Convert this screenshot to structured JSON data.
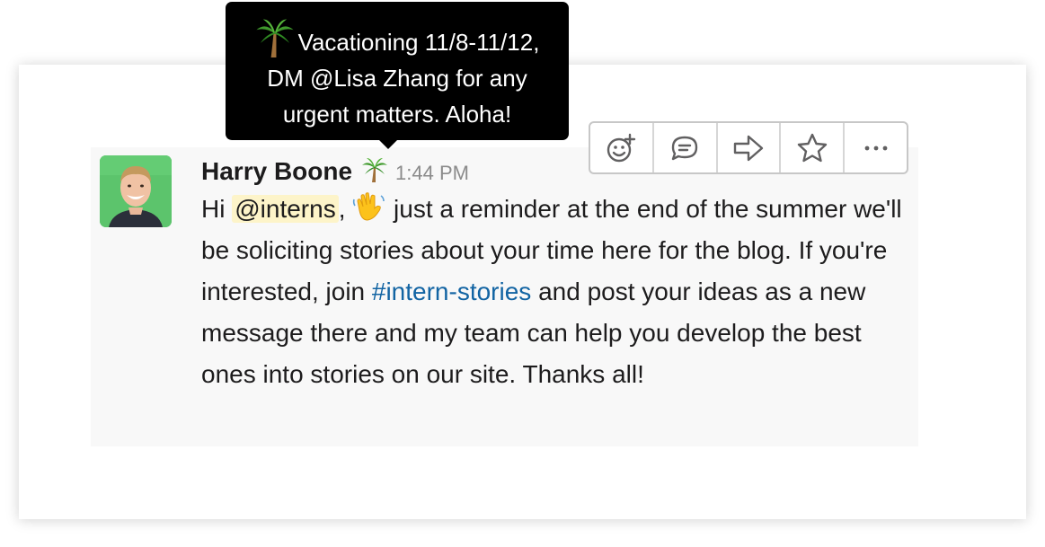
{
  "message": {
    "author": "Harry Boone",
    "status_icon": "palm-tree-icon",
    "timestamp": "1:44 PM",
    "text_hi": "Hi ",
    "mention": "@interns",
    "text_comma": ",",
    "wave_icon": "waving-hand-icon",
    "text_part1": " just a reminder at the end of the summer we'll be soliciting stories about your time here for the blog. If you're interested, join ",
    "channel": "#intern-stories",
    "text_part2": " and post your ideas as a new message there and my team can help you develop the best ones into stories on our site. Thanks all!"
  },
  "tooltip": {
    "line1": "Vacationing 11/8-11/12,",
    "line2": "DM @Lisa Zhang for any",
    "line3": "urgent matters. Aloha!"
  },
  "toolbar": {
    "actions": [
      "add-reaction-icon",
      "reply-thread-icon",
      "share-icon",
      "star-icon",
      "more-actions-icon"
    ]
  },
  "colors": {
    "mention_bg": "#fdf4c9",
    "channel_link": "#1264a3",
    "tooltip_bg": "#000000",
    "message_bg": "#f8f8f8"
  }
}
